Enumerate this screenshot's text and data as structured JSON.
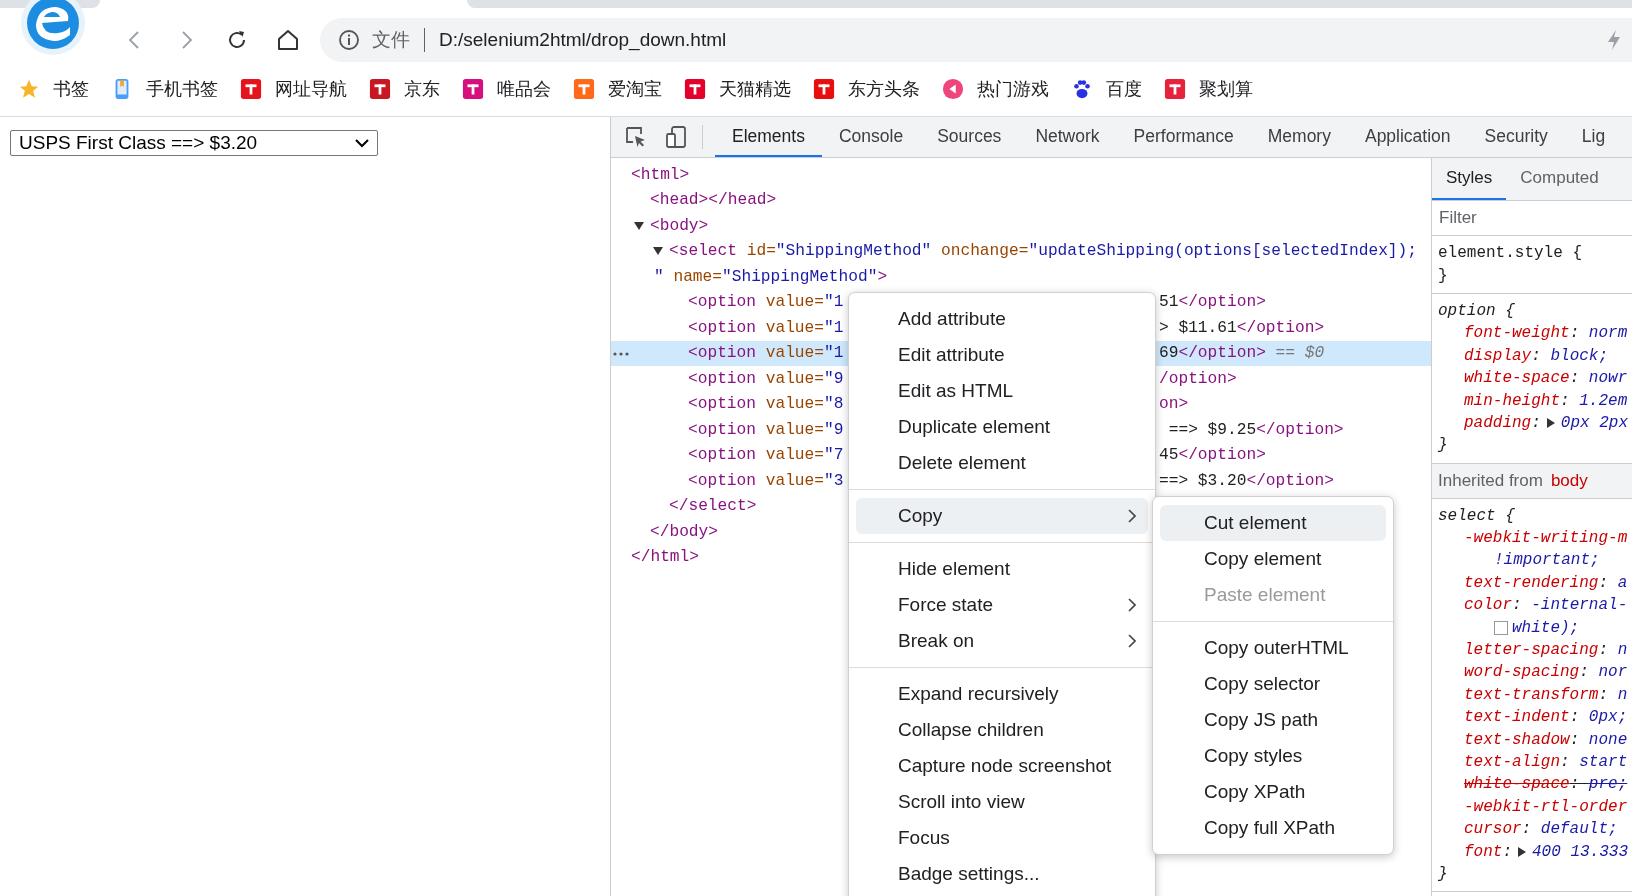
{
  "browser": {
    "address": {
      "security_label": "文件",
      "url": "D:/selenium2html/drop_down.html"
    }
  },
  "bookmarks": [
    {
      "label": "书签",
      "kind": "star",
      "color": "#f7b52c"
    },
    {
      "label": "手机书签",
      "kind": "phone",
      "color": "#4a9df8"
    },
    {
      "label": "网址导航",
      "kind": "square",
      "color": "#e5131b"
    },
    {
      "label": "京东",
      "kind": "square",
      "color": "#c91623"
    },
    {
      "label": "唯品会",
      "kind": "square",
      "color": "#d6117e"
    },
    {
      "label": "爱淘宝",
      "kind": "square",
      "color": "#ff6a1a"
    },
    {
      "label": "天猫精选",
      "kind": "square",
      "color": "#e4002b"
    },
    {
      "label": "东方头条",
      "kind": "square",
      "color": "#e8100f"
    },
    {
      "label": "热门游戏",
      "kind": "circle",
      "color": "#f0457b"
    },
    {
      "label": "百度",
      "kind": "paw",
      "color": "#2932e1"
    },
    {
      "label": "聚划算",
      "kind": "square",
      "color": "#e6233d"
    }
  ],
  "page": {
    "dropdown": {
      "value": "USPS First Class ==> $3.20"
    }
  },
  "devtools": {
    "tabs": [
      {
        "label": "Elements",
        "selected": true
      },
      {
        "label": "Console",
        "selected": false
      },
      {
        "label": "Sources",
        "selected": false
      },
      {
        "label": "Network",
        "selected": false
      },
      {
        "label": "Performance",
        "selected": false
      },
      {
        "label": "Memory",
        "selected": false
      },
      {
        "label": "Application",
        "selected": false
      },
      {
        "label": "Security",
        "selected": false
      },
      {
        "label": "Lig",
        "selected": false
      }
    ],
    "dom": [
      {
        "lines": [
          [
            {
              "kind": "tag",
              "text": "<html>"
            }
          ]
        ],
        "close": [
          {
            "kind": "tag",
            "text": "</html>"
          }
        ],
        "children": [
          {
            "lines": [
              [
                {
                  "kind": "tag",
                  "text": "<head></head>"
                }
              ]
            ]
          },
          {
            "expanded": true,
            "lines": [
              [
                {
                  "kind": "tag",
                  "text": "<body>"
                }
              ]
            ],
            "close": [
              {
                "kind": "tag",
                "text": "</body>"
              }
            ],
            "children": [
              {
                "expanded": true,
                "lines": [
                  [
                    {
                      "kind": "tag",
                      "text": "<select"
                    },
                    {
                      "kind": "attr",
                      "text": " id="
                    },
                    {
                      "kind": "val",
                      "text": "\"ShippingMethod\""
                    },
                    {
                      "kind": "attr",
                      "text": " onchange="
                    },
                    {
                      "kind": "val",
                      "text": "\"updateShipping(options[selectedIndex]);"
                    }
                  ],
                  [
                    {
                      "kind": "val",
                      "text": "\""
                    },
                    {
                      "kind": "attr",
                      "text": " name="
                    },
                    {
                      "kind": "val",
                      "text": "\"ShippingMethod\""
                    },
                    {
                      "kind": "tag",
                      "text": ">"
                    }
                  ]
                ],
                "close": [
                  {
                    "kind": "tag",
                    "text": "</select>"
                  }
                ],
                "children": [
                  {
                    "selected": false,
                    "lines": [
                      [
                        {
                          "kind": "tag",
                          "text": "<option"
                        },
                        {
                          "kind": "attr",
                          "text": " value="
                        },
                        {
                          "kind": "val",
                          "text": "\"1"
                        }
                      ]
                    ],
                    "tail": [
                      {
                        "kind": "text",
                        "text": "51"
                      },
                      {
                        "kind": "tag",
                        "text": "</option>"
                      }
                    ]
                  },
                  {
                    "selected": false,
                    "lines": [
                      [
                        {
                          "kind": "tag",
                          "text": "<option"
                        },
                        {
                          "kind": "attr",
                          "text": " value="
                        },
                        {
                          "kind": "val",
                          "text": "\"1"
                        }
                      ]
                    ],
                    "tail": [
                      {
                        "kind": "text",
                        "text": "> $11.61"
                      },
                      {
                        "kind": "tag",
                        "text": "</option>"
                      }
                    ]
                  },
                  {
                    "selected": true,
                    "lines": [
                      [
                        {
                          "kind": "tag",
                          "text": "<option"
                        },
                        {
                          "kind": "attr",
                          "text": " value="
                        },
                        {
                          "kind": "val",
                          "text": "\"1"
                        }
                      ]
                    ],
                    "tail": [
                      {
                        "kind": "text",
                        "text": "69"
                      },
                      {
                        "kind": "tag",
                        "text": "</option>"
                      },
                      {
                        "kind": "ref",
                        "text": " == $0"
                      }
                    ]
                  },
                  {
                    "selected": false,
                    "lines": [
                      [
                        {
                          "kind": "tag",
                          "text": "<option"
                        },
                        {
                          "kind": "attr",
                          "text": " value="
                        },
                        {
                          "kind": "val",
                          "text": "\"9"
                        }
                      ]
                    ],
                    "tail": [
                      {
                        "kind": "tag",
                        "text": "/option>"
                      }
                    ]
                  },
                  {
                    "selected": false,
                    "lines": [
                      [
                        {
                          "kind": "tag",
                          "text": "<option"
                        },
                        {
                          "kind": "attr",
                          "text": " value="
                        },
                        {
                          "kind": "val",
                          "text": "\"8"
                        }
                      ]
                    ],
                    "tail": [
                      {
                        "kind": "tag",
                        "text": "on>"
                      }
                    ]
                  },
                  {
                    "selected": false,
                    "lines": [
                      [
                        {
                          "kind": "tag",
                          "text": "<option"
                        },
                        {
                          "kind": "attr",
                          "text": " value="
                        },
                        {
                          "kind": "val",
                          "text": "\"9"
                        }
                      ]
                    ],
                    "tail": [
                      {
                        "kind": "text",
                        "text": " ==> $9.25"
                      },
                      {
                        "kind": "tag",
                        "text": "</option>"
                      }
                    ]
                  },
                  {
                    "selected": false,
                    "lines": [
                      [
                        {
                          "kind": "tag",
                          "text": "<option"
                        },
                        {
                          "kind": "attr",
                          "text": " value="
                        },
                        {
                          "kind": "val",
                          "text": "\"7"
                        }
                      ]
                    ],
                    "tail": [
                      {
                        "kind": "text",
                        "text": "45"
                      },
                      {
                        "kind": "tag",
                        "text": "</option>"
                      }
                    ]
                  },
                  {
                    "selected": false,
                    "lines": [
                      [
                        {
                          "kind": "tag",
                          "text": "<option"
                        },
                        {
                          "kind": "attr",
                          "text": " value="
                        },
                        {
                          "kind": "val",
                          "text": "\"3"
                        }
                      ]
                    ],
                    "tail": [
                      {
                        "kind": "text",
                        "text": "==> $3.20"
                      },
                      {
                        "kind": "tag",
                        "text": "</option>"
                      }
                    ]
                  }
                ]
              }
            ]
          }
        ]
      }
    ],
    "styles": {
      "tabs": [
        {
          "label": "Styles",
          "selected": true
        },
        {
          "label": "Computed",
          "selected": false
        }
      ],
      "filter": {
        "placeholder": "Filter"
      },
      "sections": [
        {
          "kind": "rules",
          "rules": [
            {
              "kind": "inline",
              "open": "element.style {",
              "close": "}"
            },
            {
              "kind": "agent",
              "open": "option {",
              "close": "}",
              "decls": [
                {
                  "struck": false,
                  "lines": [
                    [
                      {
                        "kind": "prop",
                        "text": "font-weight"
                      },
                      {
                        "kind": "punct",
                        "text": ": "
                      },
                      {
                        "kind": "val",
                        "text": "norm"
                      }
                    ]
                  ]
                },
                {
                  "struck": false,
                  "lines": [
                    [
                      {
                        "kind": "prop",
                        "text": "display"
                      },
                      {
                        "kind": "punct",
                        "text": ": "
                      },
                      {
                        "kind": "val",
                        "text": "block;"
                      }
                    ]
                  ]
                },
                {
                  "struck": false,
                  "lines": [
                    [
                      {
                        "kind": "prop",
                        "text": "white-space"
                      },
                      {
                        "kind": "punct",
                        "text": ": "
                      },
                      {
                        "kind": "val",
                        "text": "nowr"
                      }
                    ]
                  ]
                },
                {
                  "struck": false,
                  "lines": [
                    [
                      {
                        "kind": "prop",
                        "text": "min-height"
                      },
                      {
                        "kind": "punct",
                        "text": ": "
                      },
                      {
                        "kind": "val",
                        "text": "1.2em"
                      }
                    ]
                  ]
                },
                {
                  "struck": false,
                  "lines": [
                    [
                      {
                        "kind": "prop",
                        "text": "padding"
                      },
                      {
                        "kind": "punct",
                        "text": ":"
                      },
                      {
                        "kind": "expander"
                      },
                      {
                        "kind": "val",
                        "text": "0px 2px"
                      }
                    ]
                  ]
                }
              ]
            }
          ]
        },
        {
          "kind": "inherited",
          "label": "Inherited from",
          "source": "body"
        },
        {
          "kind": "rules",
          "rules": [
            {
              "kind": "agent",
              "open": "select {",
              "close": "}",
              "decls": [
                {
                  "struck": false,
                  "lines": [
                    [
                      {
                        "kind": "prop",
                        "text": "-webkit-writing-m"
                      }
                    ],
                    [
                      {
                        "kind": "val",
                        "text": "!important;"
                      }
                    ]
                  ]
                },
                {
                  "struck": false,
                  "lines": [
                    [
                      {
                        "kind": "prop",
                        "text": "text-rendering"
                      },
                      {
                        "kind": "punct",
                        "text": ": "
                      },
                      {
                        "kind": "val",
                        "text": "a"
                      }
                    ]
                  ]
                },
                {
                  "struck": false,
                  "lines": [
                    [
                      {
                        "kind": "prop",
                        "text": "color"
                      },
                      {
                        "kind": "punct",
                        "text": ": "
                      },
                      {
                        "kind": "val",
                        "text": "-internal-"
                      }
                    ],
                    [
                      {
                        "kind": "swatch"
                      },
                      {
                        "kind": "val",
                        "text": "white);"
                      }
                    ]
                  ]
                },
                {
                  "struck": false,
                  "lines": [
                    [
                      {
                        "kind": "prop",
                        "text": "letter-spacing"
                      },
                      {
                        "kind": "punct",
                        "text": ": "
                      },
                      {
                        "kind": "val",
                        "text": "n"
                      }
                    ]
                  ]
                },
                {
                  "struck": false,
                  "lines": [
                    [
                      {
                        "kind": "prop",
                        "text": "word-spacing"
                      },
                      {
                        "kind": "punct",
                        "text": ": "
                      },
                      {
                        "kind": "val",
                        "text": "nor"
                      }
                    ]
                  ]
                },
                {
                  "struck": false,
                  "lines": [
                    [
                      {
                        "kind": "prop",
                        "text": "text-transform"
                      },
                      {
                        "kind": "punct",
                        "text": ": "
                      },
                      {
                        "kind": "val",
                        "text": "n"
                      }
                    ]
                  ]
                },
                {
                  "struck": false,
                  "lines": [
                    [
                      {
                        "kind": "prop",
                        "text": "text-indent"
                      },
                      {
                        "kind": "punct",
                        "text": ": "
                      },
                      {
                        "kind": "val",
                        "text": "0px;"
                      }
                    ]
                  ]
                },
                {
                  "struck": false,
                  "lines": [
                    [
                      {
                        "kind": "prop",
                        "text": "text-shadow"
                      },
                      {
                        "kind": "punct",
                        "text": ": "
                      },
                      {
                        "kind": "val",
                        "text": "none"
                      }
                    ]
                  ]
                },
                {
                  "struck": false,
                  "lines": [
                    [
                      {
                        "kind": "prop",
                        "text": "text-align"
                      },
                      {
                        "kind": "punct",
                        "text": ": "
                      },
                      {
                        "kind": "val",
                        "text": "start"
                      }
                    ]
                  ]
                },
                {
                  "struck": true,
                  "lines": [
                    [
                      {
                        "kind": "prop",
                        "text": "white-space"
                      },
                      {
                        "kind": "punct",
                        "text": ": "
                      },
                      {
                        "kind": "val",
                        "text": "pre;"
                      }
                    ]
                  ]
                },
                {
                  "struck": false,
                  "lines": [
                    [
                      {
                        "kind": "prop",
                        "text": "-webkit-rtl-order"
                      }
                    ]
                  ]
                },
                {
                  "struck": false,
                  "lines": [
                    [
                      {
                        "kind": "prop",
                        "text": "cursor"
                      },
                      {
                        "kind": "punct",
                        "text": ": "
                      },
                      {
                        "kind": "val",
                        "text": "default;"
                      }
                    ]
                  ]
                },
                {
                  "struck": false,
                  "lines": [
                    [
                      {
                        "kind": "prop",
                        "text": "font"
                      },
                      {
                        "kind": "punct",
                        "text": ":"
                      },
                      {
                        "kind": "expander"
                      },
                      {
                        "kind": "val",
                        "text": "400 13.333"
                      }
                    ]
                  ]
                }
              ]
            }
          ]
        }
      ]
    }
  },
  "context_menu": {
    "groups": [
      [
        {
          "label": "Add attribute",
          "selected": false,
          "disabled": false,
          "submenu": false
        },
        {
          "label": "Edit attribute",
          "selected": false,
          "disabled": false,
          "submenu": false
        },
        {
          "label": "Edit as HTML",
          "selected": false,
          "disabled": false,
          "submenu": false
        },
        {
          "label": "Duplicate element",
          "selected": false,
          "disabled": false,
          "submenu": false
        },
        {
          "label": "Delete element",
          "selected": false,
          "disabled": false,
          "submenu": false
        }
      ],
      [
        {
          "label": "Copy",
          "selected": true,
          "disabled": false,
          "submenu": true
        }
      ],
      [
        {
          "label": "Hide element",
          "selected": false,
          "disabled": false,
          "submenu": false
        },
        {
          "label": "Force state",
          "selected": false,
          "disabled": false,
          "submenu": true
        },
        {
          "label": "Break on",
          "selected": false,
          "disabled": false,
          "submenu": true
        }
      ],
      [
        {
          "label": "Expand recursively",
          "selected": false,
          "disabled": false,
          "submenu": false
        },
        {
          "label": "Collapse children",
          "selected": false,
          "disabled": false,
          "submenu": false
        },
        {
          "label": "Capture node screenshot",
          "selected": false,
          "disabled": false,
          "submenu": false
        },
        {
          "label": "Scroll into view",
          "selected": false,
          "disabled": false,
          "submenu": false
        },
        {
          "label": "Focus",
          "selected": false,
          "disabled": false,
          "submenu": false
        },
        {
          "label": "Badge settings...",
          "selected": false,
          "disabled": false,
          "submenu": false
        }
      ]
    ],
    "submenu": {
      "groups": [
        [
          {
            "label": "Cut element",
            "selected": true,
            "disabled": false
          },
          {
            "label": "Copy element",
            "selected": false,
            "disabled": false
          },
          {
            "label": "Paste element",
            "selected": false,
            "disabled": true
          }
        ],
        [
          {
            "label": "Copy outerHTML",
            "selected": false,
            "disabled": false
          },
          {
            "label": "Copy selector",
            "selected": false,
            "disabled": false
          },
          {
            "label": "Copy JS path",
            "selected": false,
            "disabled": false
          },
          {
            "label": "Copy styles",
            "selected": false,
            "disabled": false
          },
          {
            "label": "Copy XPath",
            "selected": false,
            "disabled": false
          },
          {
            "label": "Copy full XPath",
            "selected": false,
            "disabled": false
          }
        ]
      ]
    }
  }
}
